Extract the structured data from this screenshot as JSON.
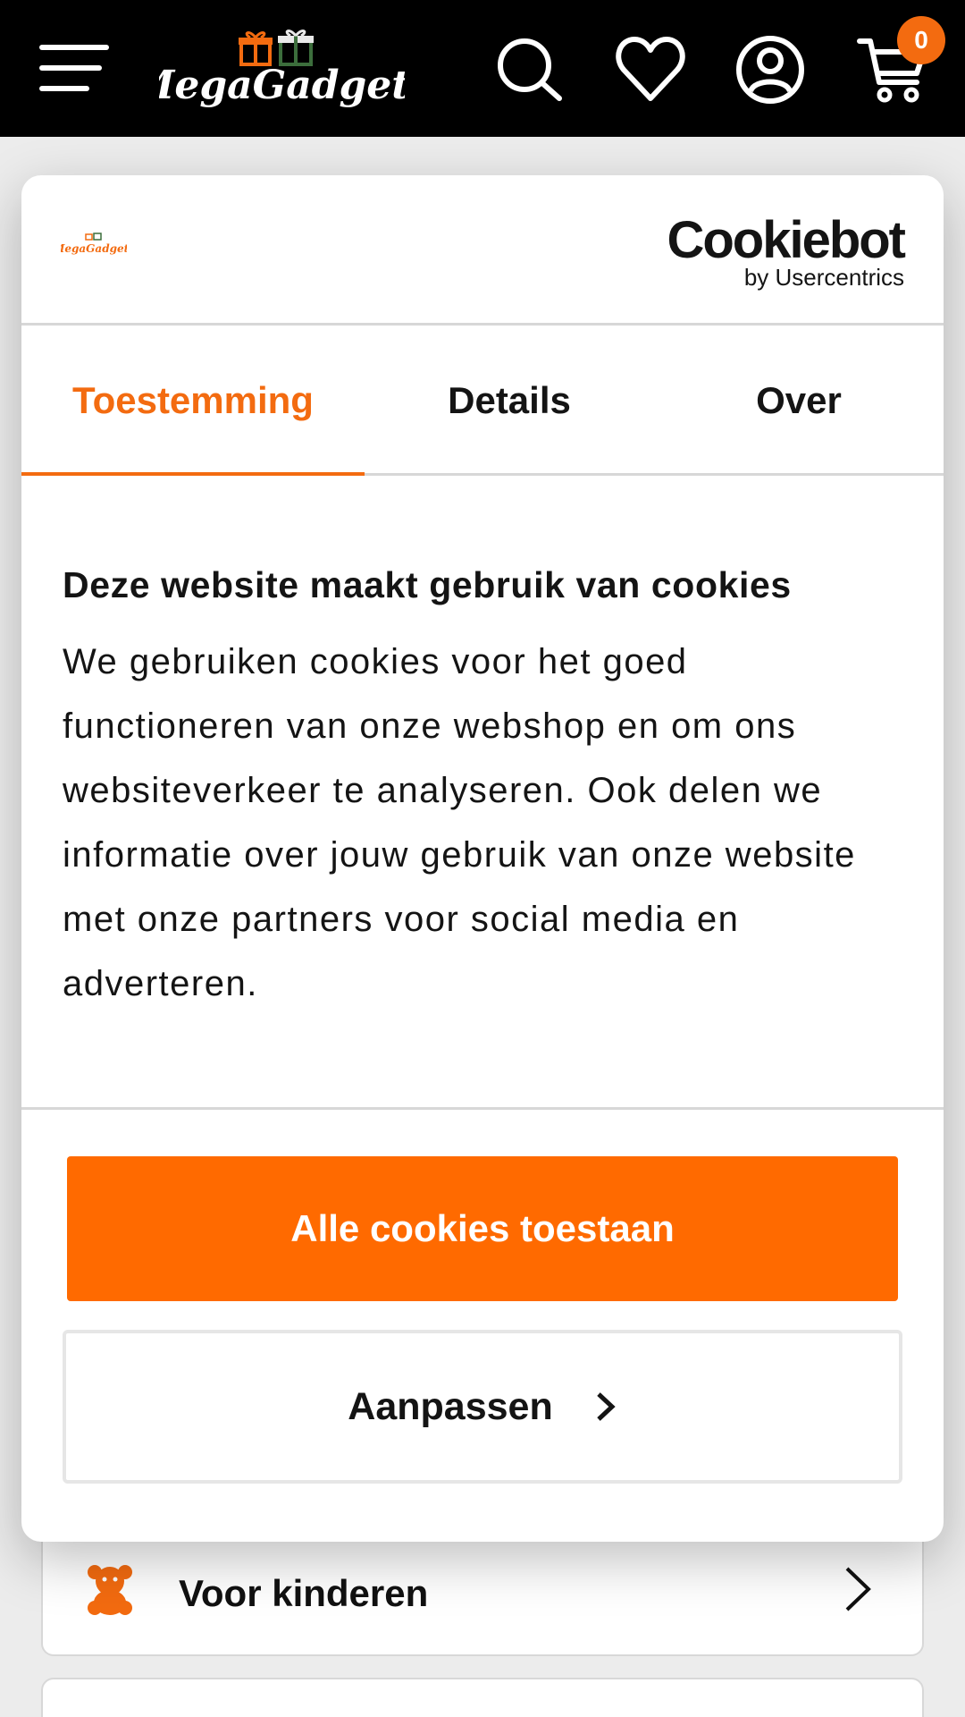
{
  "header": {
    "logo_text": "MegaGadgets",
    "cart_count": "0",
    "icons": [
      "menu-icon",
      "search-icon",
      "heart-icon",
      "account-icon",
      "cart-icon"
    ]
  },
  "dialog": {
    "brand_logo_text": "MegaGadgets",
    "provider": {
      "name": "Cookiebot",
      "by": "by Usercentrics"
    },
    "tabs": [
      {
        "label": "Toestemming",
        "active": true
      },
      {
        "label": "Details",
        "active": false
      },
      {
        "label": "Over",
        "active": false
      }
    ],
    "title": "Deze website maakt gebruik van cookies",
    "body": "We gebruiken cookies voor het goed functioneren van onze webshop en om ons websiteverkeer te analyseren. Ook delen we informatie over jouw gebruik van onze website met onze partners voor social media en adverteren.",
    "buttons": {
      "accept_all": "Alle cookies toestaan",
      "customize": "Aanpassen"
    }
  },
  "background": {
    "menu_items": [
      {
        "label": "Voor kinderen",
        "icon": "teddy-bear-icon"
      }
    ]
  },
  "colors": {
    "accent": "#f36b10",
    "button": "#ff6a00",
    "header_bg": "#000000"
  }
}
